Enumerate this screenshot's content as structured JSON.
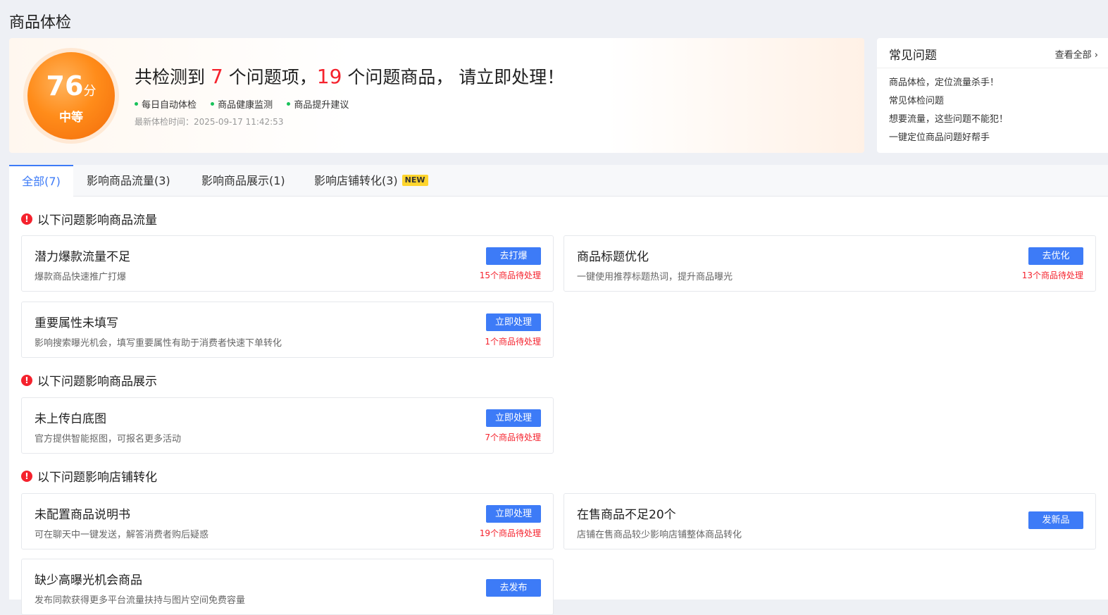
{
  "page_title": "商品体检",
  "summary": {
    "score": "76",
    "score_unit": "分",
    "level": "中等",
    "headline_prefix": "共检测到",
    "issue_count": "7",
    "headline_mid": "个问题项，",
    "product_count": "19",
    "headline_suffix": "个问题商品，  请立即处理！",
    "features": [
      "每日自动体检",
      "商品健康监测",
      "商品提升建议"
    ],
    "check_time": "最新体检时间：2025-09-17 11:42:53"
  },
  "faq": {
    "title": "常见问题",
    "more": "查看全部",
    "items": [
      "商品体检，定位流量杀手！",
      "常见体检问题",
      "想要流量，这些问题不能犯！",
      "一键定位商品问题好帮手"
    ]
  },
  "tabs": [
    {
      "label": "全部(7)"
    },
    {
      "label": "影响商品流量(3)"
    },
    {
      "label": "影响商品展示(1)"
    },
    {
      "label": "影响店铺转化(3)",
      "badge": "NEW"
    }
  ],
  "sections": [
    {
      "title": "以下问题影响商品流量",
      "cards": [
        {
          "title": "潜力爆款流量不足",
          "desc": "爆款商品快速推广打爆",
          "button": "去打爆",
          "count": "15个商品待处理"
        },
        {
          "title": "商品标题优化",
          "desc": "一键使用推荐标题热词，提升商品曝光",
          "button": "去优化",
          "count": "13个商品待处理"
        },
        {
          "title": "重要属性未填写",
          "desc": "影响搜索曝光机会，填写重要属性有助于消费者快速下单转化",
          "button": "立即处理",
          "count": "1个商品待处理"
        }
      ]
    },
    {
      "title": "以下问题影响商品展示",
      "cards": [
        {
          "title": "未上传白底图",
          "desc": "官方提供智能抠图，可报名更多活动",
          "button": "立即处理",
          "count": "7个商品待处理"
        }
      ]
    },
    {
      "title": "以下问题影响店铺转化",
      "cards": [
        {
          "title": "未配置商品说明书",
          "desc": "可在聊天中一键发送，解答消费者购后疑惑",
          "button": "立即处理",
          "count": "19个商品待处理"
        },
        {
          "title": "在售商品不足20个",
          "desc": "店铺在售商品较少影响店铺整体商品转化",
          "button": "发新品"
        },
        {
          "title": "缺少高曝光机会商品",
          "desc": "发布同款获得更多平台流量扶持与图片空间免费容量",
          "button": "去发布"
        }
      ]
    }
  ]
}
